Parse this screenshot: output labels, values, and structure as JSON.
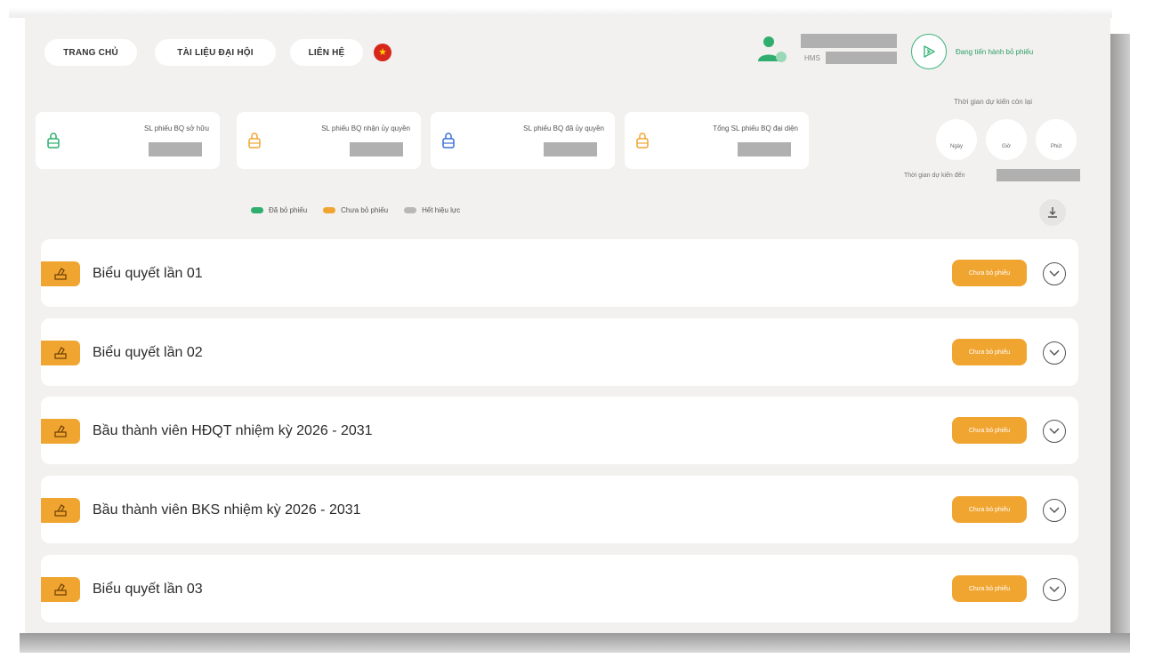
{
  "nav": {
    "home": "TRANG CHỦ",
    "documents": "TÀI LIỆU ĐẠI HỘI",
    "contact": "LIÊN HỆ"
  },
  "user": {
    "code_prefix": "HMS"
  },
  "vote_status": {
    "label": "Đang tiến hành bỏ phiếu"
  },
  "stats": [
    {
      "label": "SL phiếu BQ sở hữu",
      "icon": "lock-icon",
      "color": "#2fae6e"
    },
    {
      "label": "SL phiếu BQ nhận ủy quyền",
      "icon": "lock-icon",
      "color": "#f0a531"
    },
    {
      "label": "SL phiếu BQ đã ủy quyền",
      "icon": "lock-icon",
      "color": "#3b6fd6"
    },
    {
      "label": "Tổng SL phiếu BQ đại diện",
      "icon": "lock-icon",
      "color": "#f0a531"
    }
  ],
  "countdown": {
    "title": "Thời gian dự kiến còn lại",
    "units": [
      "Ngày",
      "Giờ",
      "Phút"
    ],
    "expected_label": "Thời gian dự kiến đến"
  },
  "legend": [
    {
      "label": "Đã bỏ phiếu",
      "color": "#2fae6e"
    },
    {
      "label": "Chưa bỏ phiếu",
      "color": "#f0a531"
    },
    {
      "label": "Hết hiệu lực",
      "color": "#b8b8b8"
    }
  ],
  "sessions": [
    {
      "title": "Biểu quyết lần 01",
      "status": "Chưa bỏ phiếu"
    },
    {
      "title": "Biểu quyết lần 02",
      "status": "Chưa bỏ phiếu"
    },
    {
      "title": "Bầu thành viên HĐQT nhiệm kỳ 2026 - 2031",
      "status": "Chưa bỏ phiếu"
    },
    {
      "title": "Bầu thành viên BKS nhiệm kỳ 2026 - 2031",
      "status": "Chưa bỏ phiếu"
    },
    {
      "title": "Biểu quyết lần 03",
      "status": "Chưa bỏ phiếu"
    }
  ],
  "colors": {
    "accent": "#f0a531",
    "green": "#2fae6e",
    "background": "#f2f1ef"
  }
}
